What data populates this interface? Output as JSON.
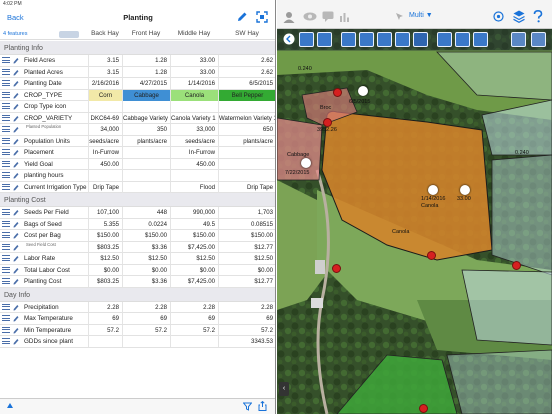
{
  "status_bar": {
    "time": "4:02 PM"
  },
  "nav": {
    "back_label": "Back",
    "title": "Planting"
  },
  "header": {
    "features_label": "4 features",
    "columns": [
      "Back Hay",
      "Front Hay",
      "Middle Hay",
      "SW Hay"
    ]
  },
  "sections": [
    {
      "title": "Planting Info",
      "rows": [
        {
          "label": "Field Acres",
          "values": [
            "3.15",
            "1.28",
            "33.00",
            "2.62"
          ]
        },
        {
          "label": "Planted Acres",
          "values": [
            "3.15",
            "1.28",
            "33.00",
            "2.62"
          ]
        },
        {
          "label": "Planting Date",
          "values": [
            "2/16/2016",
            "4/27/2015",
            "1/14/2016",
            "6/5/2015"
          ]
        },
        {
          "label": "CROP_TYPE",
          "values": [
            "Corn",
            "Cabbage",
            "Canola",
            "Bell Pepper"
          ]
        },
        {
          "label": "Crop Type icon",
          "values": [
            "",
            "",
            "",
            ""
          ]
        },
        {
          "label": "CROP_VARIETY",
          "values": [
            "DKC64-69",
            "Cabbage Variety 1",
            "Canola Variety 1",
            "Watermelon Variety 1"
          ]
        },
        {
          "label": "Planted Population",
          "sublabel": "Planted Population",
          "values": [
            "34,000",
            "350",
            "33,000",
            "650"
          ]
        },
        {
          "label": "Population Units",
          "values": [
            "seeds/acre",
            "plants/acre",
            "seeds/acre",
            "plants/acre"
          ]
        },
        {
          "label": "Placement",
          "values": [
            "In-Furrow",
            "",
            "In-Furrow",
            ""
          ]
        },
        {
          "label": "Yield Goal",
          "values": [
            "450.00",
            "",
            "450.00",
            ""
          ]
        },
        {
          "label": "planting hours",
          "values": [
            "",
            "",
            "",
            ""
          ]
        },
        {
          "label": "Current Irrigation Type",
          "values": [
            "Drip Tape",
            "",
            "Flood",
            "Drip Tape"
          ]
        }
      ]
    },
    {
      "title": "Planting Cost",
      "rows": [
        {
          "label": "Seeds Per Field",
          "values": [
            "107,100",
            "448",
            "990,000",
            "1,703"
          ]
        },
        {
          "label": "Bags of Seed",
          "values": [
            "5.355",
            "0.0224",
            "49.5",
            "0.08515"
          ]
        },
        {
          "label": "Cost per Bag",
          "values": [
            "$150.00",
            "$150.00",
            "$150.00",
            "$150.00"
          ]
        },
        {
          "label": "Seed Field Cost",
          "sublabel": "Seed Field Cost",
          "values": [
            "$803.25",
            "$3.36",
            "$7,425.00",
            "$12.77"
          ]
        },
        {
          "label": "Labor Rate",
          "values": [
            "$12.50",
            "$12.50",
            "$12.50",
            "$12.50"
          ]
        },
        {
          "label": "Total Labor Cost",
          "values": [
            "$0.00",
            "$0.00",
            "$0.00",
            "$0.00"
          ]
        },
        {
          "label": "Planting Cost",
          "values": [
            "$803.25",
            "$3.36",
            "$7,425.00",
            "$12.77"
          ]
        }
      ]
    },
    {
      "title": "Day Info",
      "rows": [
        {
          "label": "Precipitation",
          "values": [
            "2.28",
            "2.28",
            "2.28",
            "2.28"
          ]
        },
        {
          "label": "Max Temperature",
          "values": [
            "69",
            "69",
            "69",
            "69"
          ]
        },
        {
          "label": "Min Temperature",
          "values": [
            "57.2",
            "57.2",
            "57.2",
            "57.2"
          ]
        },
        {
          "label": "GDDs since plant",
          "values": [
            "",
            "",
            "",
            "3343.53"
          ]
        }
      ]
    }
  ],
  "crop_colors": {
    "Corn": "#f2e9a8",
    "Cabbage": "#3f8fd4",
    "Canola": "#9be07a",
    "Bell Pepper": "#33aa33"
  },
  "map": {
    "multi_label": "Multi ▼",
    "labels": {
      "broc": "Broc",
      "date_6_5": "6/5/2015",
      "val_3952": "3952.26",
      "cabbage": "Cabbage",
      "date_7_22": "7/22/2015",
      "val_0_240_a": "0.240",
      "val_0_240_b": "0.240",
      "date_1_14": "1/14/2016",
      "canola_small": "Canola",
      "val_33": "33.00",
      "canola": "Canola"
    }
  },
  "accent_color": "#1a73d9",
  "field_color_canola": "#d4832a"
}
